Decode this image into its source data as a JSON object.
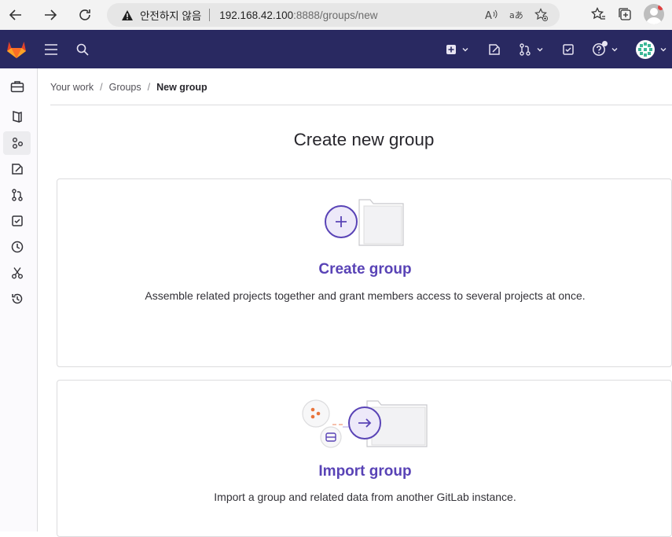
{
  "browser": {
    "security_label": "안전하지 않음",
    "url_host": "192.168.42.100",
    "url_path": ":8888/groups/new"
  },
  "breadcrumb": {
    "items": [
      "Your work",
      "Groups",
      "New group"
    ],
    "separator": "/"
  },
  "page": {
    "title": "Create new group"
  },
  "options": [
    {
      "title": "Create group",
      "description": "Assemble related projects together and grant members access to several projects at once.",
      "icon": "folder-plus-illustration"
    },
    {
      "title": "Import group",
      "description": "Import a group and related data from another GitLab instance.",
      "icon": "folder-import-illustration"
    }
  ],
  "colors": {
    "topbar_bg": "#292961",
    "accent": "#5943b6",
    "tanuki": "#e24329"
  }
}
